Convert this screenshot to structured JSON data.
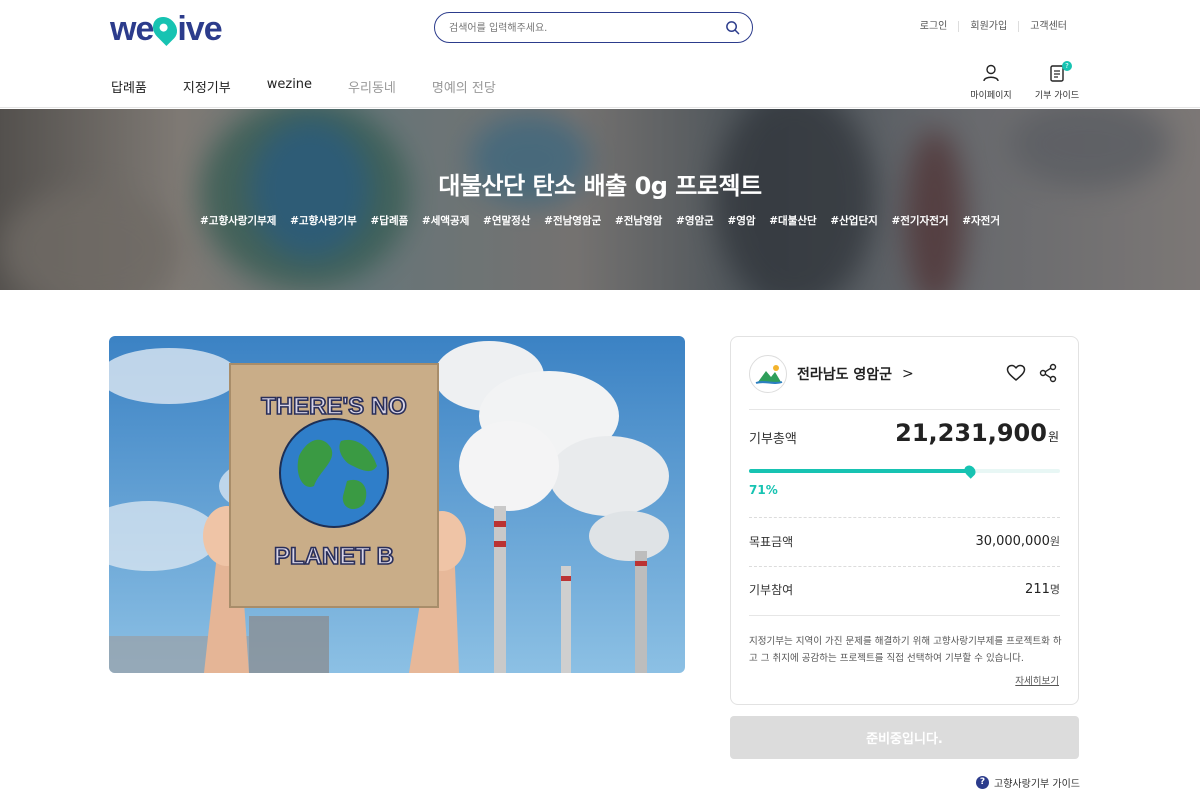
{
  "header": {
    "logo": "we·ive",
    "search_placeholder": "검색어를 입력해주세요.",
    "util_links": [
      "로그인",
      "회원가입",
      "고객센터"
    ],
    "nav": [
      {
        "label": "답례품",
        "active": true
      },
      {
        "label": "지정기부",
        "active": true
      },
      {
        "label": "wezine",
        "active": true
      },
      {
        "label": "우리동네",
        "active": false
      },
      {
        "label": "명예의 전당",
        "active": false
      }
    ],
    "mypage_label": "마이페이지",
    "guide_label": "기부 가이드",
    "guide_badge": "?"
  },
  "hero": {
    "title": "대불산단 탄소 배출 0g 프로젝트",
    "tags": [
      "#고향사랑기부제",
      "#고향사랑기부",
      "#답례품",
      "#세액공제",
      "#연말정산",
      "#전남영암군",
      "#전남영암",
      "#영암군",
      "#영암",
      "#대불산단",
      "#산업단지",
      "#전기자전거",
      "#자전거"
    ]
  },
  "photo": {
    "sign_text_top": "THERE'S NO",
    "sign_text_bottom": "PLANET B"
  },
  "card": {
    "org_name": "전라남도 영암군",
    "org_chevron": ">",
    "total_label": "기부총액",
    "total_value": "21,231,900",
    "currency": "원",
    "progress_percent": 71,
    "progress_label": "71%",
    "goal_label": "목표금액",
    "goal_value": "30,000,000",
    "participants_label": "기부참여",
    "participants_value": "211",
    "participants_unit": "명",
    "description": "지정기부는 지역이 가진 문제를 해결하기 위해 고향사랑기부제를 프로젝트화 하고 그 취지에 공감하는 프로젝트를 직접 선택하여 기부할 수 있습니다.",
    "more_link": "자세히보기"
  },
  "cta_label": "준비중입니다.",
  "footer_guide": {
    "icon": "?",
    "label": "고향사랑기부 가이드"
  },
  "colors": {
    "brand": "#2c3c8c",
    "accent": "#17c3b2",
    "disabled": "#dcdcdc"
  }
}
